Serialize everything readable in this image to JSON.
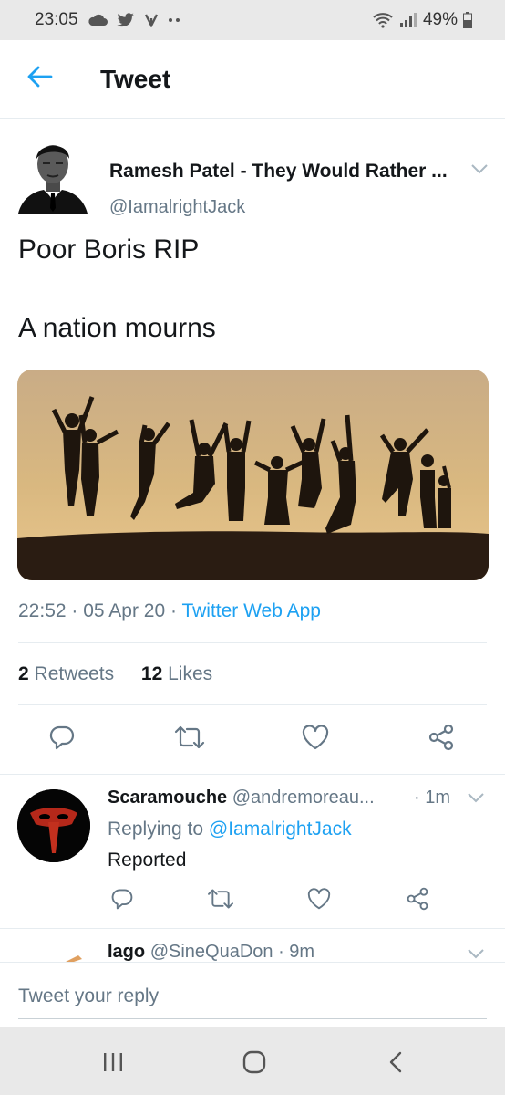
{
  "status_bar": {
    "time": "23:05",
    "battery": "49%",
    "icons": [
      "cloud-icon",
      "twitter-bird-icon",
      "vine-icon",
      "more-dots-icon",
      "wifi-icon",
      "signal-icon",
      "battery-icon"
    ]
  },
  "header": {
    "title": "Tweet",
    "back_icon": "arrow-left-icon"
  },
  "tweet": {
    "author_name": "Ramesh Patel - They Would Rather ...",
    "author_handle": "@IamalrightJack",
    "text_line1": "Poor Boris RIP",
    "text_line2": "A nation mourns",
    "image": "silhouettes-jumping-at-sunset",
    "time": "22:52",
    "date": "05 Apr 20",
    "source": "Twitter Web App",
    "retweets_count": "2",
    "retweets_label": "Retweets",
    "likes_count": "12",
    "likes_label": "Likes"
  },
  "actions": [
    "reply-icon",
    "retweet-icon",
    "like-icon",
    "share-icon"
  ],
  "replies": [
    {
      "name": "Scaramouche",
      "handle": "@andremoreau...",
      "time": "· 1m",
      "replying_prefix": "Replying to",
      "replying_to": "@IamalrightJack",
      "text": "Reported"
    },
    {
      "name": "Iago",
      "handle": "@SineQuaDon",
      "time": "· 9m"
    }
  ],
  "compose": {
    "placeholder": "Tweet your reply"
  },
  "navbar": [
    "recents-icon",
    "home-icon",
    "back-icon"
  ],
  "colors": {
    "accent": "#1da1f2",
    "text": "#14171a",
    "secondary_text": "#657786",
    "system_bar": "#e9e9e9"
  }
}
